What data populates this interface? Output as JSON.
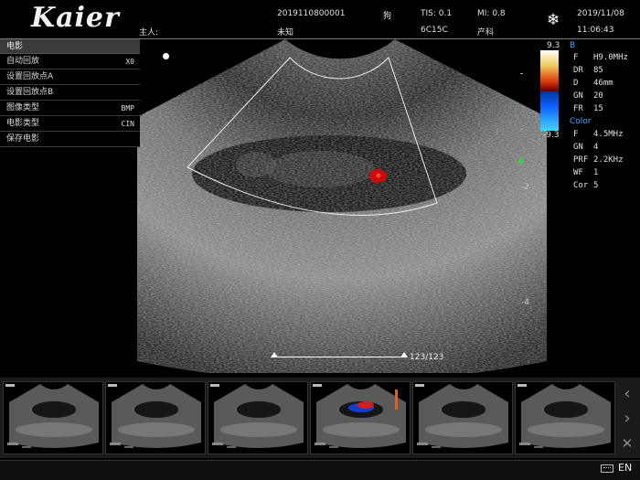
{
  "header": {
    "logo": "Kaier",
    "patient_label": "主人:",
    "id": "2019110800001",
    "name": "未知",
    "species": "狗",
    "tis": "TIS: 0.1",
    "mi": "MI: 0.8",
    "probe": "6C15C",
    "exam": "产科",
    "date": "2019/11/08",
    "time": "11:06:43",
    "freeze_icon": "snowflake-icon"
  },
  "cine_menu": {
    "title": "电影",
    "items": [
      {
        "label": "自动回放",
        "value": "X0"
      },
      {
        "label": "设置回放点A",
        "value": ""
      },
      {
        "label": "设置回放点B",
        "value": ""
      },
      {
        "label": "图像类型",
        "value": "BMP"
      },
      {
        "label": "电影类型",
        "value": "CIN"
      },
      {
        "label": "保存电影",
        "value": ""
      }
    ]
  },
  "colorbar": {
    "top": "9.3",
    "bottom": "-9.3"
  },
  "b_mode": {
    "label": "B",
    "params": [
      {
        "k": "F",
        "v": "H9.0MHz"
      },
      {
        "k": "DR",
        "v": "85"
      },
      {
        "k": "D",
        "v": "46mm"
      },
      {
        "k": "GN",
        "v": "20"
      },
      {
        "k": "FR",
        "v": "15"
      }
    ]
  },
  "color_mode": {
    "label": "Color",
    "params": [
      {
        "k": "F",
        "v": "4.5MHz"
      },
      {
        "k": "GN",
        "v": "4"
      },
      {
        "k": "PRF",
        "v": "2.2KHz"
      },
      {
        "k": "WF",
        "v": "1"
      },
      {
        "k": "Cor",
        "v": "5"
      }
    ]
  },
  "depth_marks": [
    "-2",
    "-4"
  ],
  "cine": {
    "frame_counter": "123/123"
  },
  "thumbnails": [
    {
      "name": "thumbnail-1",
      "doppler": false
    },
    {
      "name": "thumbnail-2",
      "doppler": false
    },
    {
      "name": "thumbnail-3",
      "doppler": false
    },
    {
      "name": "thumbnail-4",
      "doppler": true
    },
    {
      "name": "thumbnail-5",
      "doppler": false
    },
    {
      "name": "thumbnail-6",
      "doppler": false
    }
  ],
  "thumb_nav": {
    "prev": "‹",
    "next": "›",
    "delete": "✕"
  },
  "status_bar": {
    "lang": "EN",
    "keyboard_icon": "keyboard-icon"
  },
  "colors": {
    "accent": "#3fa8ff",
    "focus_marker": "#2cdc3c"
  }
}
